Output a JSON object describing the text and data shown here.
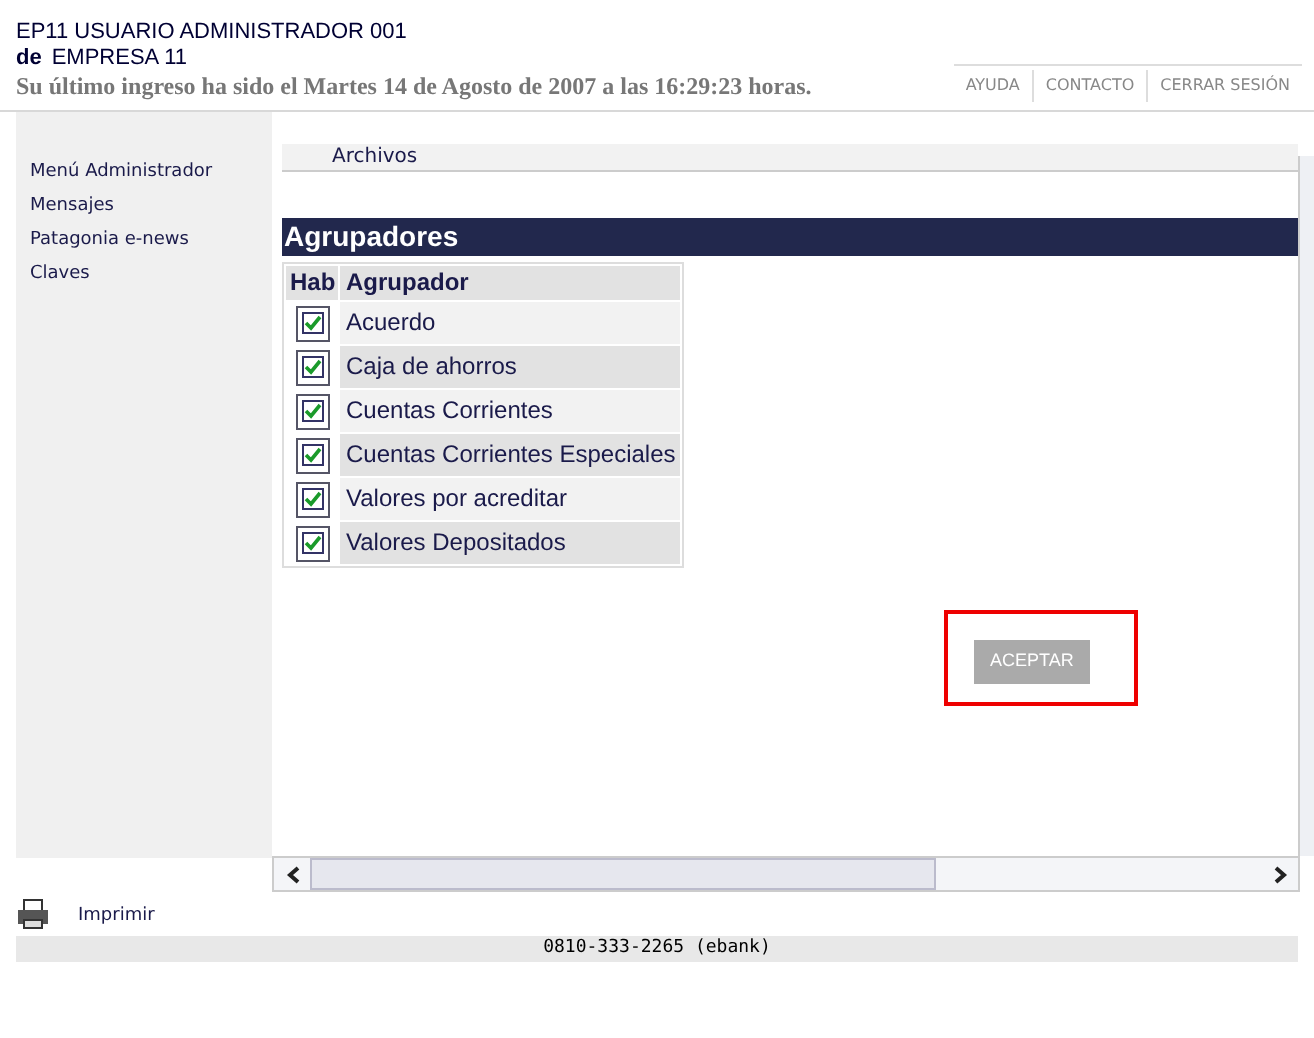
{
  "header": {
    "user": "EP11 USUARIO ADMINISTRADOR 001",
    "company_prefix": "de",
    "company": "EMPRESA 11",
    "last_login": "Su último ingreso ha sido el Martes 14 de Agosto de 2007 a las 16:29:23 horas."
  },
  "top_links": [
    "AYUDA",
    "CONTACTO",
    "CERRAR SESIÓN"
  ],
  "sidebar": {
    "items": [
      {
        "label": "Menú Administrador"
      },
      {
        "label": "Mensajes"
      },
      {
        "label": "Patagonia e-news"
      },
      {
        "label": "Claves"
      }
    ]
  },
  "previous_row": {
    "label": "Archivos"
  },
  "section": {
    "title": "Agrupadores",
    "columns": [
      "Hab",
      "Agrupador"
    ],
    "rows": [
      {
        "label": "Acuerdo",
        "checked": true
      },
      {
        "label": "Caja de ahorros",
        "checked": true
      },
      {
        "label": "Cuentas Corrientes",
        "checked": true
      },
      {
        "label": "Cuentas Corrientes Especiales",
        "checked": true
      },
      {
        "label": "Valores por acreditar",
        "checked": true
      },
      {
        "label": "Valores Depositados",
        "checked": true
      }
    ]
  },
  "accept_button": "ACEPTAR",
  "print_link": "Imprimir",
  "footer": "0810-333-2265 (ebank)"
}
